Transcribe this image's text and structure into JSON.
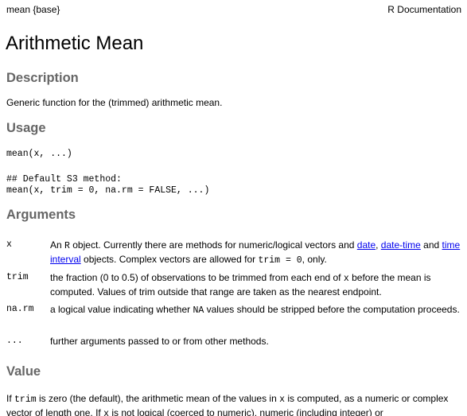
{
  "header": {
    "topic": "mean {base}",
    "doc_label": "R Documentation"
  },
  "title": "Arithmetic Mean",
  "sections": {
    "description": "Description",
    "usage": "Usage",
    "arguments": "Arguments",
    "value": "Value"
  },
  "description_text": "Generic function for the (trimmed) arithmetic mean.",
  "usage": {
    "line1": "mean(x, ...)",
    "comment": "## Default S3 method:",
    "line2": "mean(x, trim = 0, na.rm = FALSE, ...)"
  },
  "arguments": {
    "x": {
      "name": "x",
      "t1": "An ",
      "c1": "R",
      "t2": " object. Currently there are methods for numeric/logical vectors and ",
      "link1": "date",
      "t3": ", ",
      "link2": "date-time",
      "t4": " and ",
      "link3": "time interval",
      "t5": " objects. Complex vectors are allowed for ",
      "c2": "trim = 0",
      "t6": ", only."
    },
    "trim": {
      "name": "trim",
      "text": "the fraction (0 to 0.5) of observations to be trimmed from each end of ",
      "c1": "x",
      "text2": " before the mean is computed. Values of trim outside that range are taken as the nearest endpoint."
    },
    "na_rm": {
      "name": "na.rm",
      "t1": "a logical value indicating whether ",
      "c1": "NA",
      "t2": " values should be stripped before the computation proceeds."
    },
    "dots": {
      "name": "...",
      "text": "further arguments passed to or from other methods."
    }
  },
  "value": {
    "t1": "If ",
    "c1": "trim",
    "t2": " is zero (the default), the arithmetic mean of the values in ",
    "c2": "x",
    "t3": " is computed, as a numeric or complex vector of length one. If ",
    "c3": "x",
    "t4": " is not logical (coerced to numeric), numeric (including integer) or"
  }
}
